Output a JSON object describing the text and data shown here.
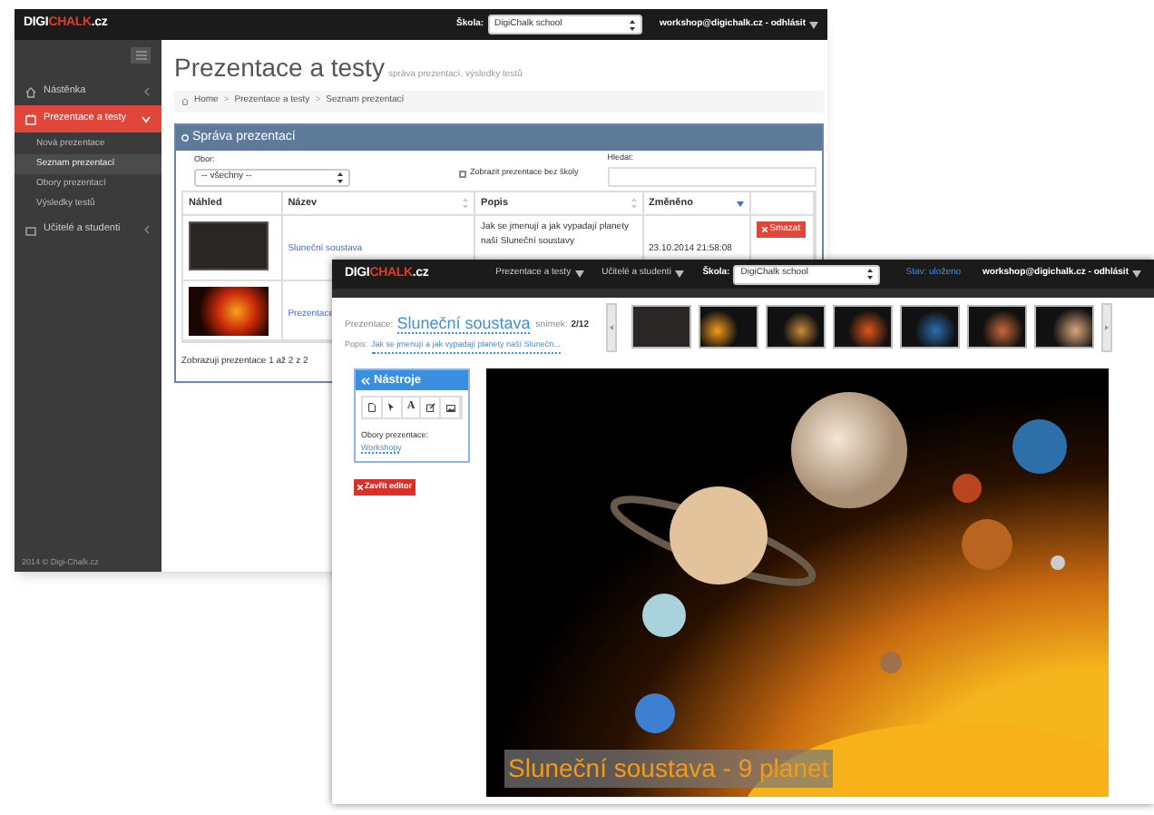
{
  "back_window": {
    "logo": [
      "DIGI",
      "CHALK",
      ".cz"
    ],
    "school_label": "Škola:",
    "school_select": "DigiChalk school",
    "user": "workshop@digichalk.cz - odhlásit",
    "sidebar": {
      "items": [
        {
          "label": "Nástěnka",
          "selected": false
        },
        {
          "label": "Prezentace a testy",
          "selected": true,
          "expanded": true,
          "children": [
            {
              "label": "Nová prezentace",
              "selected": false
            },
            {
              "label": "Seznam prezentací",
              "selected": true
            },
            {
              "label": "Obory prezentací",
              "selected": false
            },
            {
              "label": "Výsledky testů",
              "selected": false
            }
          ]
        },
        {
          "label": "Učitelé a studenti",
          "selected": false
        }
      ],
      "footer": "2014 © Digi-Chalk.cz"
    },
    "page_title": "Prezentace a testy",
    "page_subtitle": "správa prezentací, výsledky testů",
    "breadcrumb": [
      "Home",
      "Prezentace a testy",
      "Seznam prezentací"
    ],
    "breadcrumb_separator": ">",
    "panel": {
      "title": "Správa prezentací",
      "filter_label": "Obor:",
      "filter_value": "-- všechny --",
      "checkbox": {
        "label": "Zobrazit prezentace bez školy",
        "checked": false
      },
      "search_label": "Hledat:",
      "table": {
        "columns": [
          {
            "label": "Náhled",
            "sortable": false
          },
          {
            "label": "Název",
            "sortable": true,
            "sorted": false
          },
          {
            "label": "Popis",
            "sortable": true,
            "sorted": false
          },
          {
            "label": "Změněno",
            "sortable": true,
            "sorted": true
          },
          {
            "sortable": false
          }
        ],
        "rows": [
          {
            "name": "Sluneční soustava",
            "description": "Jak se jmenují a jak vypadají planety naší Sluneční soustavy",
            "changed": "23.10.2014 21:58:08",
            "action": "Smazat"
          },
          {
            "name": "Prezentace"
          }
        ]
      },
      "info": "Zobrazuji prezentace 1 až 2 z 2"
    }
  },
  "front_window": {
    "logo": [
      "DIGI",
      "CHALK",
      ".cz"
    ],
    "menu": [
      "Prezentace a testy",
      "Učitelé a studenti"
    ],
    "school_label": "Škola:",
    "school_select": "DigiChalk school",
    "status": "Stav: uloženo",
    "user": "workshop@digichalk.cz - odhlásit",
    "presentation_label": "Prezentace:",
    "presentation_title": "Sluneční soustava",
    "slide_label": "snímek:",
    "slide_number": "2/12",
    "description_label": "Popis:",
    "description": "Jak se jmenují a jak vypadají planety naší Slunečn...",
    "tools": {
      "title": "Nástroje",
      "buttons": [
        {
          "kind": "page"
        },
        {
          "kind": "pointer"
        },
        {
          "kind": "text",
          "label": "A"
        },
        {
          "kind": "edit"
        },
        {
          "kind": "image"
        }
      ],
      "category_label": "Obory prezentace:",
      "category": "Workshopy"
    },
    "close_button": "Zavřít editor",
    "slide": {
      "caption": "Sluneční soustava - 9 planet"
    }
  }
}
